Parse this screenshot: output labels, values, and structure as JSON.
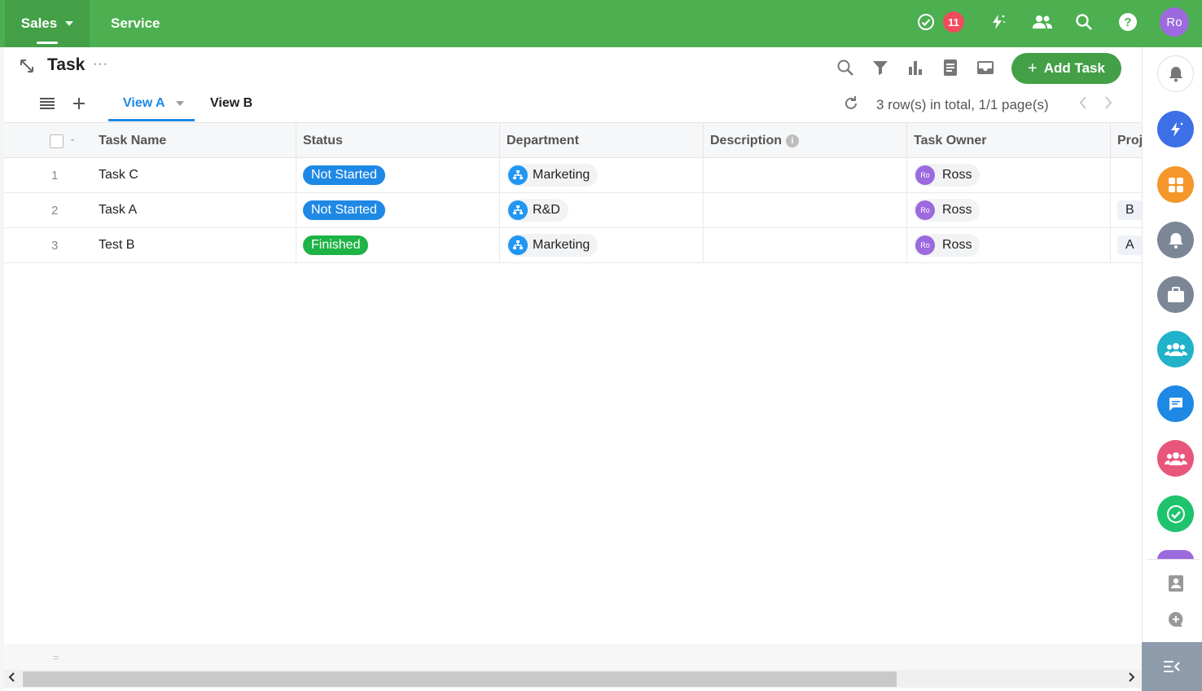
{
  "topbar": {
    "tabs": [
      {
        "label": "Sales"
      },
      {
        "label": "Service"
      }
    ],
    "notification_count": "11",
    "user_initials": "Ro",
    "color": "#4caf50"
  },
  "header": {
    "title": "Task",
    "more": "···",
    "add_button": "Add Task"
  },
  "views": {
    "tabs": [
      {
        "label": "View A",
        "active": true
      },
      {
        "label": "View B",
        "active": false
      }
    ],
    "row_count": "3 row(s) in total, 1/1 page(s)"
  },
  "table": {
    "columns": [
      "Task Name",
      "Status",
      "Department",
      "Description",
      "Task Owner",
      "Proj"
    ],
    "rows": [
      {
        "num": "1",
        "name": "Task C",
        "status": "Not Started",
        "department": "Marketing",
        "description": "",
        "owner": "Ross",
        "owner_initials": "Ro",
        "project": ""
      },
      {
        "num": "2",
        "name": "Task A",
        "status": "Not Started",
        "department": "R&D",
        "description": "",
        "owner": "Ross",
        "owner_initials": "Ro",
        "project": "B"
      },
      {
        "num": "3",
        "name": "Test B",
        "status": "Finished",
        "department": "Marketing",
        "description": "",
        "owner": "Ross",
        "owner_initials": "Ro",
        "project": "A"
      }
    ],
    "status_colors": {
      "Not Started": "#1e88e5",
      "Finished": "#1db345"
    }
  },
  "footer": {
    "handle": "="
  },
  "icons": [
    "expand-icon",
    "search-icon",
    "filter-icon",
    "bar-chart-icon",
    "document-icon",
    "inbox-icon",
    "list-icon",
    "plus-icon",
    "refresh-icon",
    "chevron-left-icon",
    "chevron-right-icon",
    "check-circle-icon",
    "magic-icon",
    "people-icon",
    "help-icon",
    "bell-icon",
    "apps-icon",
    "briefcase-icon",
    "group-icon",
    "chat-icon",
    "check-icon",
    "contact-icon",
    "add-comment-icon",
    "collapse-menu-icon"
  ]
}
